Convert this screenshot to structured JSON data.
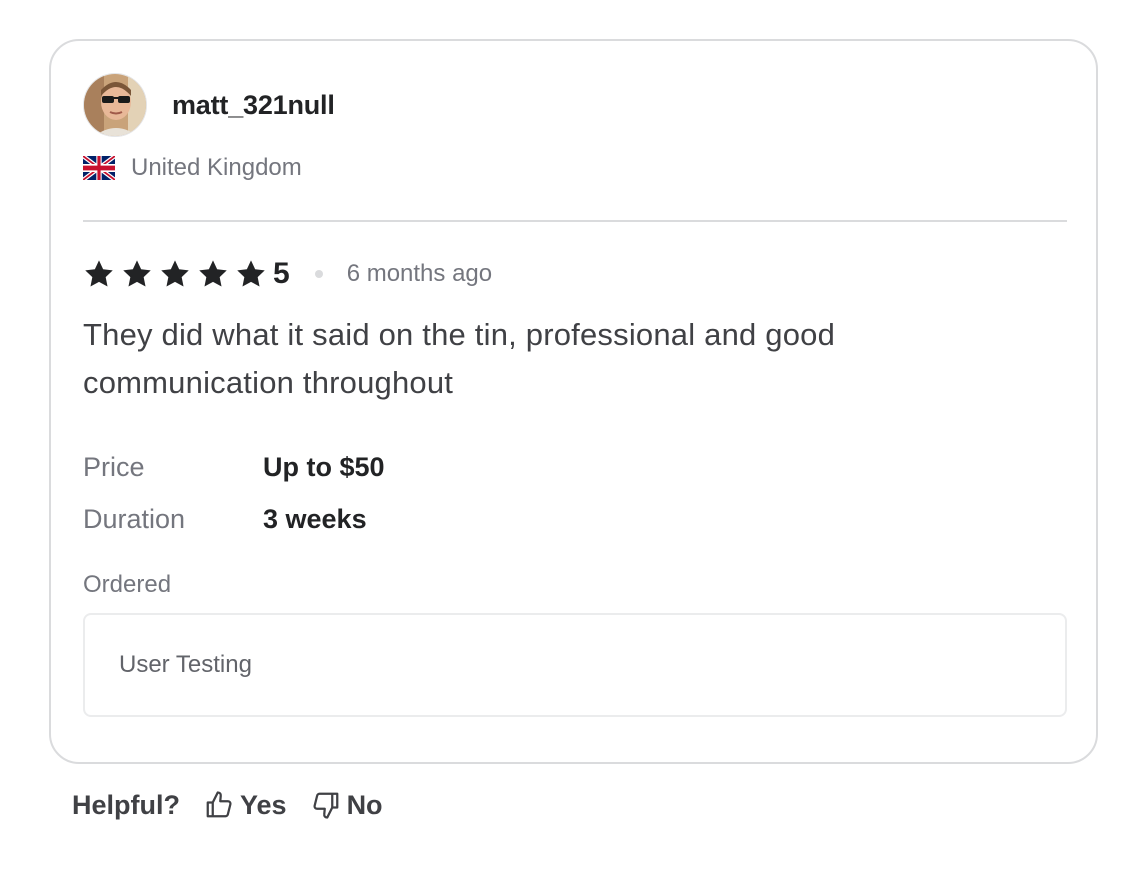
{
  "review": {
    "username": "matt_321null",
    "country": "United Kingdom",
    "rating": "5",
    "rating_fraction": 1.0,
    "time_ago": "6 months ago",
    "text": "They did what it said on the tin, professional and good communication throughout",
    "details": [
      {
        "label": "Price",
        "value": "Up to $50"
      },
      {
        "label": "Duration",
        "value": "3 weeks"
      }
    ],
    "ordered_label": "Ordered",
    "ordered_item": "User Testing"
  },
  "helpful": {
    "label": "Helpful?",
    "yes_label": "Yes",
    "no_label": "No"
  },
  "icons": {
    "avatar": "user-avatar",
    "flag": "uk-flag-icon",
    "star": "star-icon",
    "yes": "thumbs-up-icon",
    "no": "thumbs-down-icon"
  },
  "colors": {
    "text_primary": "#222325",
    "text_secondary": "#74767e",
    "border": "#dadbdd"
  }
}
